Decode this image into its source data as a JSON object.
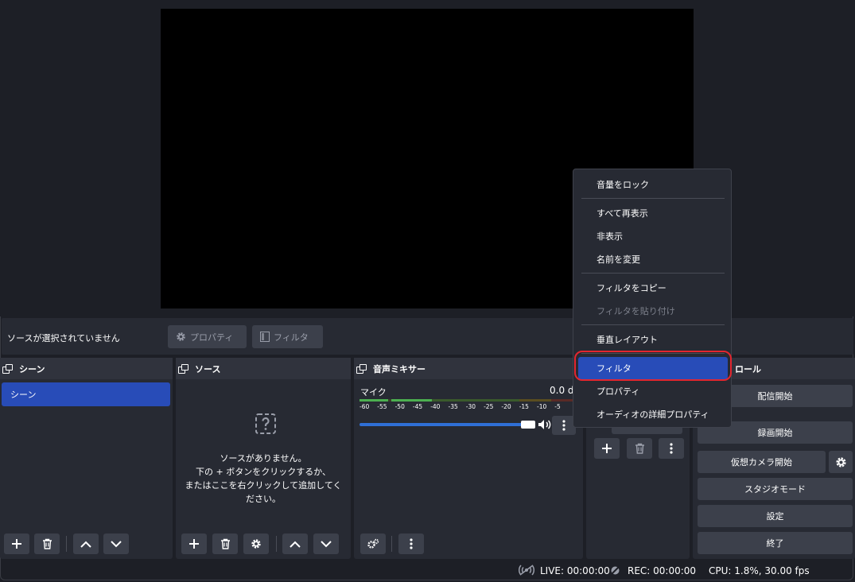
{
  "context_bar": {
    "no_source_text": "ソースが選択されていません",
    "properties_label": "プロパティ",
    "filters_label": "フィルタ"
  },
  "scenes": {
    "title": "シーン",
    "items": [
      {
        "label": "シーン"
      }
    ]
  },
  "sources": {
    "title": "ソース",
    "empty_line1": "ソースがありません。",
    "empty_line2": "下の + ボタンをクリックするか、",
    "empty_line3": "またはここを右クリックして追加してく",
    "empty_line4": "ださい。"
  },
  "mixer": {
    "title": "音声ミキサー",
    "channel_name": "マイク",
    "level": "0.0 d",
    "scale": [
      "-60",
      "-55",
      "-50",
      "-45",
      "-40",
      "-35",
      "-30",
      "-25",
      "-20",
      "-15",
      "-10",
      "-5"
    ],
    "volume_fraction": 1.0
  },
  "controls": {
    "title_partial": "ロール",
    "start_streaming": "配信開始",
    "start_recording": "録画開始",
    "start_virtual_camera": "仮想カメラ開始",
    "studio_mode": "スタジオモード",
    "settings": "設定",
    "exit": "終了"
  },
  "context_menu": {
    "items": [
      {
        "label": "音量をロック",
        "disabled": false
      },
      {
        "label": "すべて再表示",
        "disabled": false
      },
      {
        "label": "非表示",
        "disabled": false
      },
      {
        "label": "名前を変更",
        "disabled": false
      },
      {
        "label": "フィルタをコピー",
        "disabled": false
      },
      {
        "label": "フィルタを貼り付け",
        "disabled": true
      },
      {
        "label": "垂直レイアウト",
        "disabled": false
      },
      {
        "label": "フィルタ",
        "disabled": false,
        "selected": true
      },
      {
        "label": "プロパティ",
        "disabled": false
      },
      {
        "label": "オーディオの詳細プロパティ",
        "disabled": false
      }
    ]
  },
  "status": {
    "live": "LIVE: 00:00:00",
    "rec": "REC: 00:00:00",
    "cpu": "CPU: 1.8%, 30.00 fps"
  },
  "colors": {
    "accent": "#284cb8",
    "highlight_ring": "#e3262f",
    "meter_green": "#4caf50",
    "meter_yellow": "#c8a426",
    "meter_red": "#c0392b"
  }
}
